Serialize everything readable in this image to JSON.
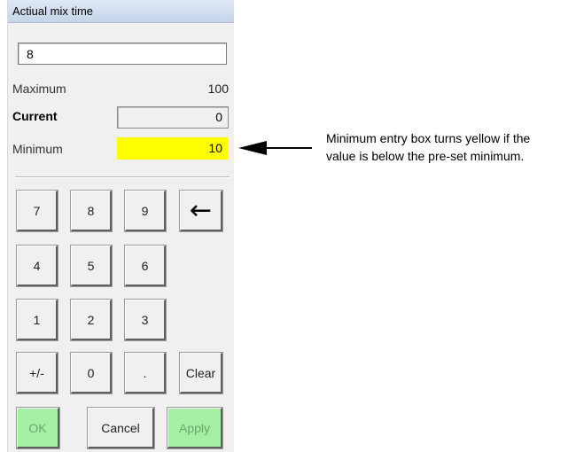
{
  "window": {
    "title": "Actiual mix time"
  },
  "entry": {
    "value": "8"
  },
  "fields": {
    "maximum": {
      "label": "Maximum",
      "value": "100"
    },
    "current": {
      "label": "Current",
      "value": "0"
    },
    "minimum": {
      "label": "Minimum",
      "value": "10",
      "highlight_color": "#ffff00"
    }
  },
  "keypad": {
    "row1": [
      "7",
      "8",
      "9"
    ],
    "row2": [
      "4",
      "5",
      "6"
    ],
    "row3": [
      "1",
      "2",
      "3"
    ],
    "row4": [
      "+/-",
      "0",
      ".",
      "Clear"
    ],
    "backspace_icon": "left-arrow-icon"
  },
  "actions": {
    "ok": "OK",
    "cancel": "Cancel",
    "apply": "Apply",
    "disabled_color": "#a6f0a6"
  },
  "annotation": {
    "line1": "Minimum entry box turns yellow if the",
    "line2": "value is below the pre-set minimum."
  }
}
